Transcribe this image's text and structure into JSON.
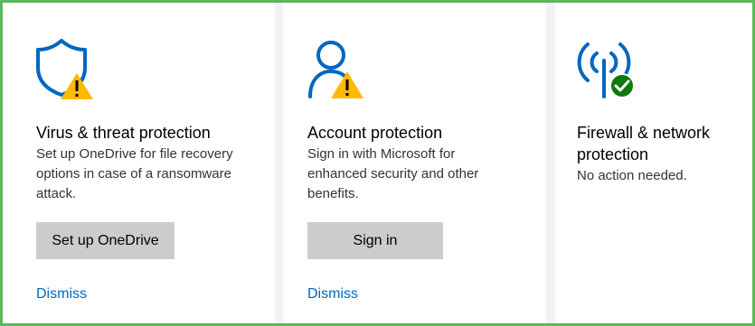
{
  "cards": [
    {
      "icon": "shield-warning-icon",
      "title": "Virus & threat protection",
      "description_lines": [
        "Set up OneDrive for file recovery",
        "options in case of a ransomware",
        "attack."
      ],
      "button_label": "Set up OneDrive",
      "link_label": "Dismiss"
    },
    {
      "icon": "person-warning-icon",
      "title": "Account protection",
      "description_lines": [
        "Sign in with Microsoft for",
        "enhanced security and other",
        "benefits."
      ],
      "button_label": "Sign in",
      "link_label": "Dismiss"
    },
    {
      "icon": "wifi-antenna-check-icon",
      "title_lines": [
        "Firewall & network",
        "protection"
      ],
      "description_lines": [
        "No action needed."
      ]
    }
  ],
  "colors": {
    "accent": "#0067c0",
    "warning": "#ffb900",
    "ok": "#0e7a0d",
    "button_bg": "#cccccc",
    "frame_border": "#5cb85c"
  }
}
